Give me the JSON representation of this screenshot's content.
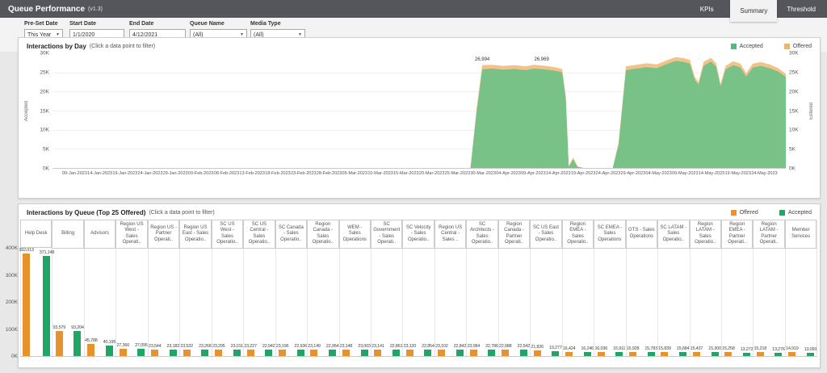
{
  "header": {
    "title": "Queue Performance",
    "version": "(v1.3)",
    "tabs": [
      {
        "label": "KPIs",
        "active": false
      },
      {
        "label": "Summary",
        "active": true
      },
      {
        "label": "Threshold",
        "active": false
      }
    ]
  },
  "filters": {
    "preset_date": {
      "label": "Pre-Set Date",
      "value": "This Year"
    },
    "start_date": {
      "label": "Start Date",
      "value": "1/1/2020"
    },
    "end_date": {
      "label": "End Date",
      "value": "4/12/2021"
    },
    "queue_name": {
      "label": "Queue Name",
      "value": "(All)"
    },
    "media_type": {
      "label": "Media Type",
      "value": "(All)"
    }
  },
  "colors": {
    "header_bg": "#54565c",
    "area_accepted": "#79c287",
    "area_offered": "#f3c289",
    "bar_offered": "#e8922f",
    "bar_accepted": "#21a567"
  },
  "chart_data": [
    {
      "type": "area",
      "title": "Interactions by Day",
      "subtitle": "(Click a data point to filter)",
      "legend": [
        {
          "label": "Accepted",
          "color": "#57b784"
        },
        {
          "label": "Offered",
          "color": "#f2b267"
        }
      ],
      "y_left_label": "Accepted",
      "y_right_label": "Entered",
      "y_ticks": [
        "30K",
        "25K",
        "20K",
        "15K",
        "10K",
        "5K",
        "0K"
      ],
      "ymax": 30,
      "units": "thousands",
      "x_ticks": [
        "09-Jan-2023",
        "14-Jan-2023",
        "19-Jan-2023",
        "24-Jan-2023",
        "29-Jan-2023",
        "03-Feb-2023",
        "08-Feb-2023",
        "13-Feb-2023",
        "18-Feb-2023",
        "23-Feb-2023",
        "28-Feb-2023",
        "05-Mar-2023",
        "10-Mar-2023",
        "15-Mar-2023",
        "20-Mar-2023",
        "25-Mar-2023",
        "30-Mar-2023",
        "04-Apr-2023",
        "09-Apr-2023",
        "14-Apr-2023",
        "19-Apr-2023",
        "24-Apr-2023",
        "29-Apr-2023",
        "04-May-2023",
        "09-May-2023",
        "14-May-2023",
        "19-May-2023",
        "24-May-2023"
      ],
      "annotations": [
        {
          "x": 0.586,
          "y": 27.0,
          "label": "26,994"
        },
        {
          "x": 0.667,
          "y": 27.1,
          "label": "26,969"
        }
      ],
      "points": [
        [
          0,
          0,
          0
        ],
        [
          0.57,
          0,
          0
        ],
        [
          0.578,
          14,
          15
        ],
        [
          0.586,
          25.8,
          26.9
        ],
        [
          0.6,
          26,
          27
        ],
        [
          0.615,
          25.7,
          26.7
        ],
        [
          0.63,
          25.9,
          26.9
        ],
        [
          0.645,
          25.6,
          26.6
        ],
        [
          0.656,
          26,
          27
        ],
        [
          0.67,
          25.8,
          26.8
        ],
        [
          0.684,
          25.5,
          26.4
        ],
        [
          0.695,
          25,
          25.9
        ],
        [
          0.7,
          18,
          18.8
        ],
        [
          0.704,
          0.3,
          0.5
        ],
        [
          0.71,
          2.3,
          2.7
        ],
        [
          0.716,
          0.3,
          0.4
        ],
        [
          0.724,
          0,
          0
        ],
        [
          0.764,
          0,
          0
        ],
        [
          0.772,
          6,
          6.8
        ],
        [
          0.782,
          25.6,
          26.6
        ],
        [
          0.796,
          26,
          27
        ],
        [
          0.81,
          26.4,
          27.4
        ],
        [
          0.824,
          26.1,
          27.1
        ],
        [
          0.838,
          27.2,
          28.2
        ],
        [
          0.85,
          28,
          29
        ],
        [
          0.861,
          27.7,
          28.7
        ],
        [
          0.869,
          27.3,
          28.3
        ],
        [
          0.876,
          23,
          23.8
        ],
        [
          0.881,
          21.8,
          22.5
        ],
        [
          0.888,
          26.8,
          27.8
        ],
        [
          0.898,
          27.8,
          28.8
        ],
        [
          0.905,
          26.5,
          27.4
        ],
        [
          0.911,
          21.3,
          22
        ],
        [
          0.918,
          25.8,
          26.7
        ],
        [
          0.928,
          26.9,
          27.9
        ],
        [
          0.938,
          26.3,
          27.3
        ],
        [
          0.946,
          23.9,
          24.8
        ],
        [
          0.955,
          26.3,
          27.3
        ],
        [
          0.966,
          26.7,
          27.7
        ],
        [
          0.978,
          26.1,
          27.1
        ],
        [
          0.99,
          25.2,
          26.1
        ],
        [
          1,
          23.8,
          24.6
        ]
      ]
    },
    {
      "type": "bar",
      "title": "Interactions by Queue (Top 25 Offered)",
      "subtitle": "(Click a data point to filter)",
      "legend": [
        {
          "label": "Offered",
          "color": "#e8922f"
        },
        {
          "label": "Accepted",
          "color": "#21a567"
        }
      ],
      "y_ticks": [
        "400K",
        "300K",
        "200K",
        "100K",
        "0K"
      ],
      "ylim": [
        0,
        400000
      ],
      "categories": [
        "Help Desk",
        "Billing",
        "Advisors",
        "Region US West - Sales Operati..",
        "Region US - Partner Operati..",
        "Region US East - Sales Operatio..",
        "SC US West - Sales Operatio..",
        "SC US Central - Sales Operatio..",
        "SC Canada - Sales Operatio..",
        "Region Canada - Sales Operatio..",
        "WEM - Sales Operations",
        "SC Government - Sales Operati..",
        "SC Velocity - Sales Operatio..",
        "Region US Central - Sales ..",
        "SC Architects - Sales Operatio..",
        "Region Canada - Partner Operati..",
        "SC US East - Sales Operatio..",
        "Region EMEA - Sales Operatio..",
        "SC EMEA - Sales Operations",
        "GTS - Sales Operations",
        "SC LATAM - Sales Operatio..",
        "Region LATAM - Sales Operatio..",
        "Region EMEA - Partner Operati..",
        "Region LATAM - Partner Operati..",
        "Member Services"
      ],
      "series": [
        {
          "name": "Offered",
          "values": [
            392013,
            93579,
            45788,
            27360,
            23544,
            23532,
            23295,
            23227,
            23196,
            23149,
            23148,
            23141,
            23120,
            23102,
            23084,
            22988,
            21826,
            16424,
            16036,
            15928,
            15839,
            15437,
            15258,
            15218,
            14919
          ]
        },
        {
          "name": "Accepted",
          "values": [
            371148,
            93204,
            40195,
            27095,
            23182,
            23268,
            23011,
            22942,
            22936,
            22954,
            23003,
            22861,
            22854,
            22842,
            22786,
            22542,
            19277,
            16246,
            15911,
            15783,
            15684,
            15300,
            13272,
            13276,
            13093
          ]
        }
      ]
    }
  ]
}
